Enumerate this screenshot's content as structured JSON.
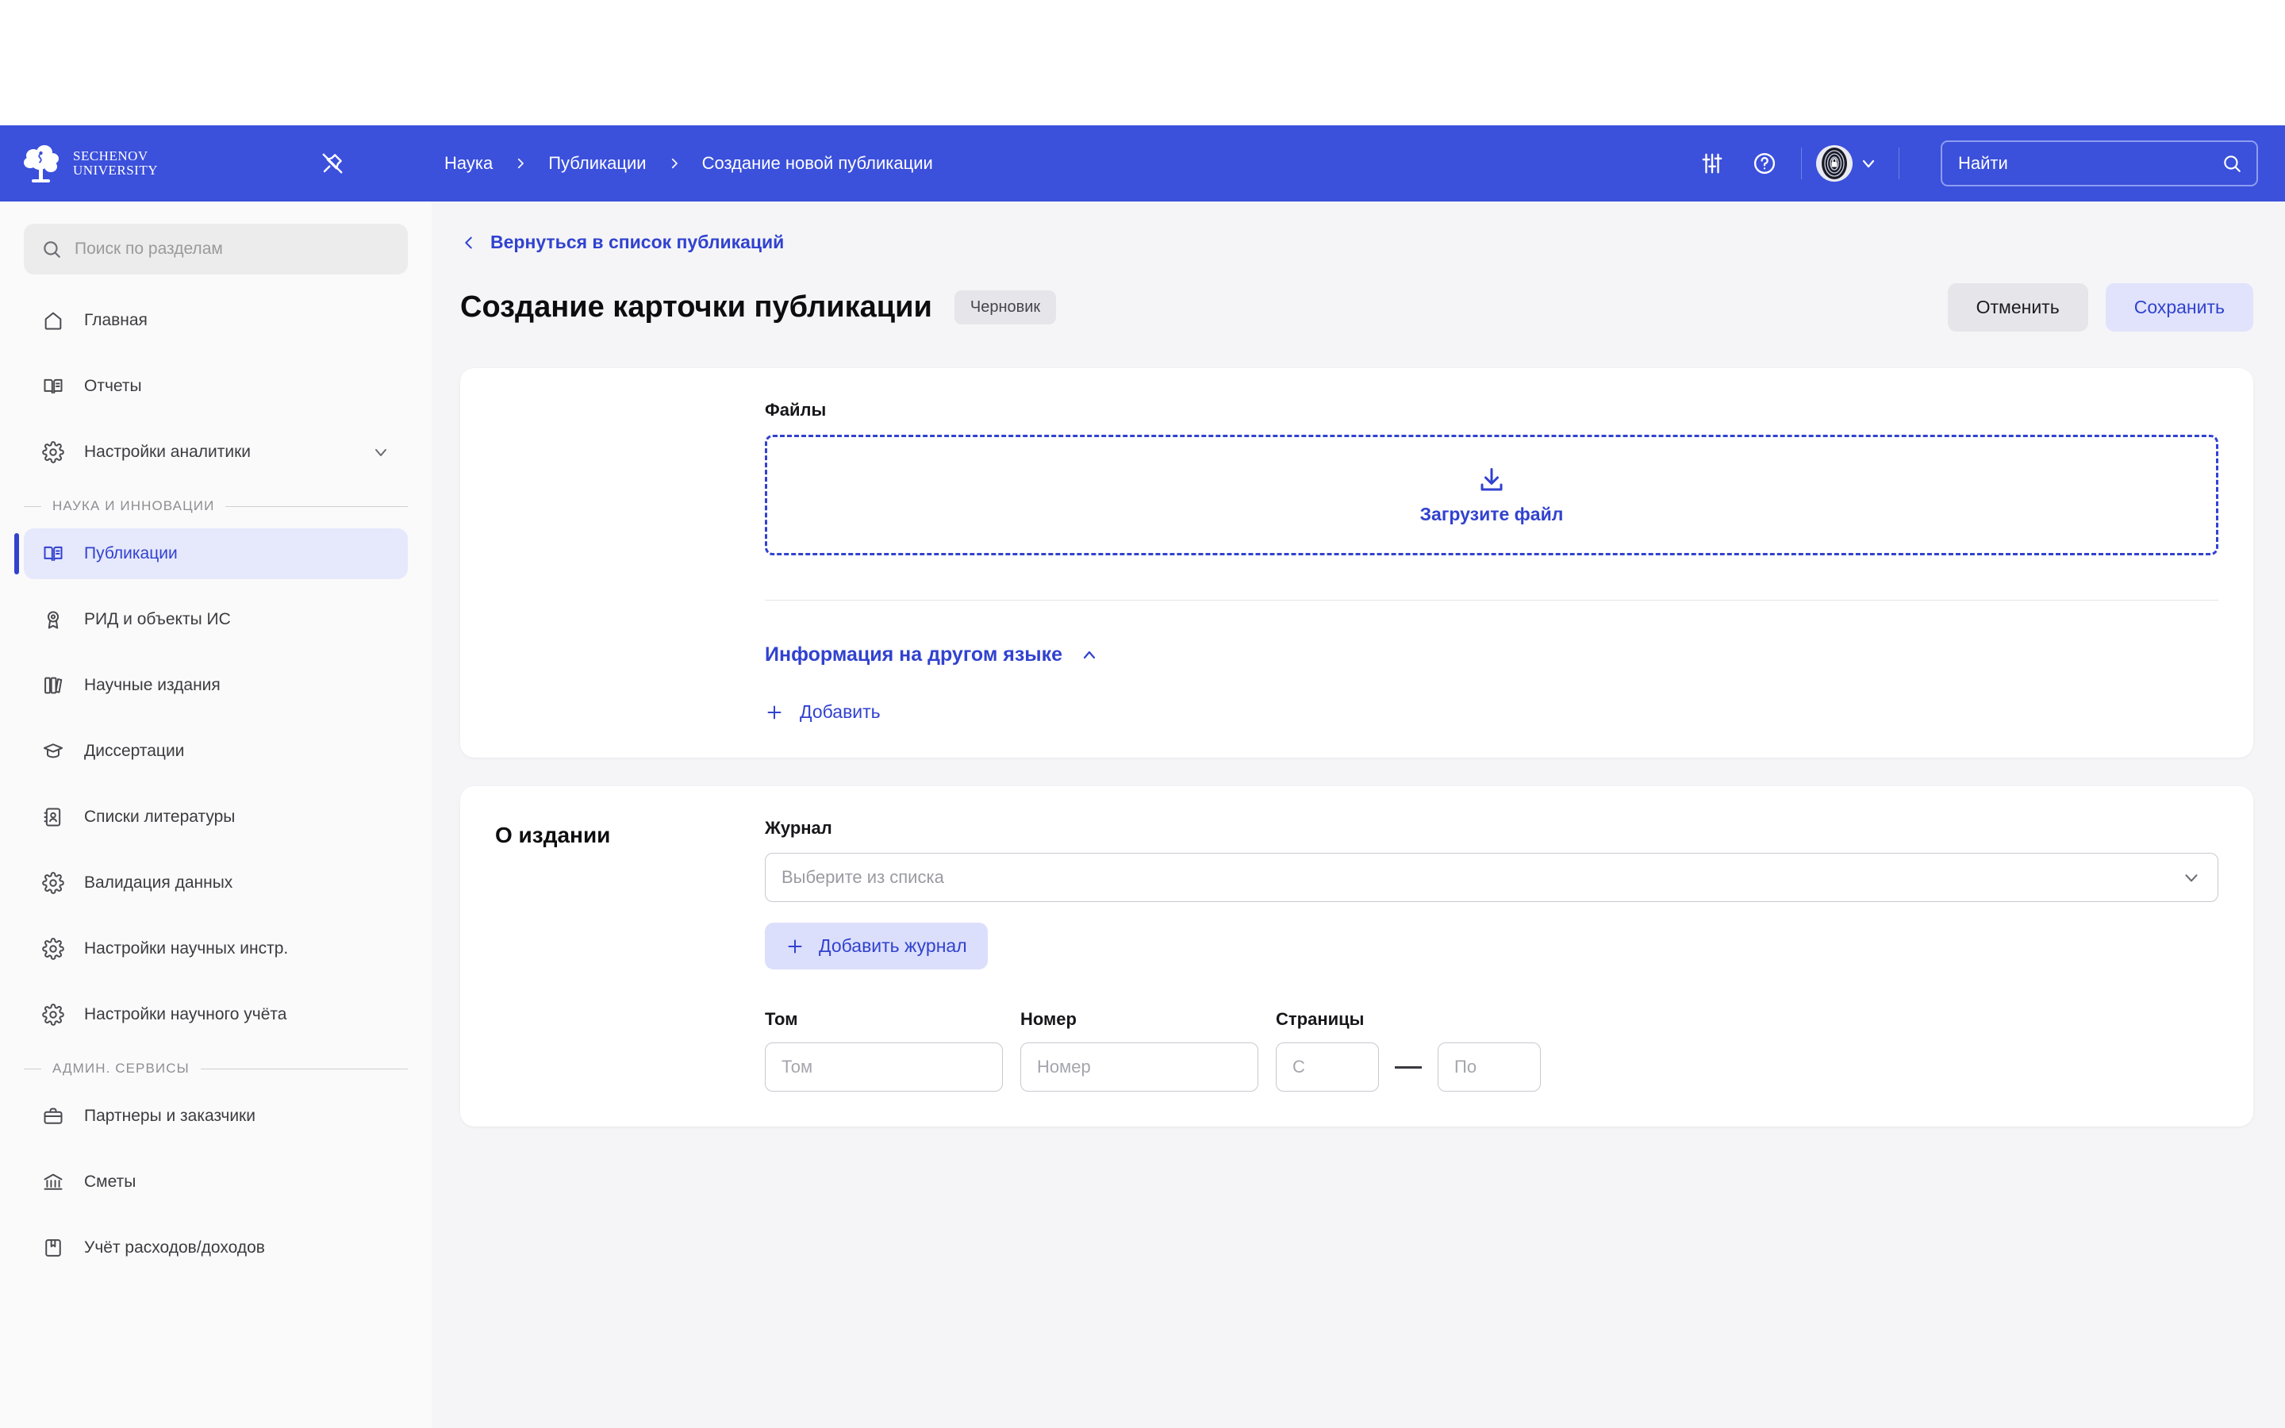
{
  "header": {
    "logo": {
      "line1": "SECHENOV",
      "line2": "UNIVERSITY",
      "icon": "sechenov-tree-logo"
    },
    "pin_icon": "pin-off-icon",
    "breadcrumb": [
      {
        "label": "Наука"
      },
      {
        "label": "Публикации"
      },
      {
        "label": "Создание новой публикации"
      }
    ],
    "icons": {
      "settings": "sliders-icon",
      "help": "help-circle-icon",
      "avatar": "user-avatar",
      "chevron": "chevron-down-icon"
    },
    "search": {
      "placeholder": "Найти",
      "value": "",
      "icon": "search-icon"
    },
    "accent_color": "#3B50DB"
  },
  "sidebar": {
    "search": {
      "placeholder": "Поиск по разделам",
      "value": "",
      "icon": "search-icon"
    },
    "items": [
      {
        "label": "Главная",
        "icon": "home-icon",
        "active": false
      },
      {
        "label": "Отчеты",
        "icon": "book-open-icon",
        "active": false
      },
      {
        "label": "Настройки аналитики",
        "icon": "gear-icon",
        "active": false,
        "expandable": true
      }
    ],
    "group_science": {
      "label": "НАУКА И ИННОВАЦИИ"
    },
    "science_items": [
      {
        "label": "Публикации",
        "icon": "book-open-icon",
        "active": true
      },
      {
        "label": "РИД и объекты ИС",
        "icon": "award-icon",
        "active": false
      },
      {
        "label": "Научные издания",
        "icon": "books-icon",
        "active": false
      },
      {
        "label": "Диссертации",
        "icon": "graduation-cap-icon",
        "active": false
      },
      {
        "label": "Списки литературы",
        "icon": "contact-book-icon",
        "active": false
      },
      {
        "label": "Валидация данных",
        "icon": "gear-icon",
        "active": false
      },
      {
        "label": "Настройки научных инстр.",
        "icon": "gear-icon",
        "active": false
      },
      {
        "label": "Настройки научного учёта",
        "icon": "gear-icon",
        "active": false
      }
    ],
    "group_admin": {
      "label": "АДМИН. СЕРВИСЫ"
    },
    "admin_items": [
      {
        "label": "Партнеры и заказчики",
        "icon": "briefcase-icon",
        "active": false
      },
      {
        "label": "Сметы",
        "icon": "bank-icon",
        "active": false
      },
      {
        "label": "Учёт расходов/доходов",
        "icon": "ledger-icon",
        "active": false
      }
    ],
    "active_bg": "#e6e8fc",
    "active_color": "#3142cf"
  },
  "main": {
    "back_link": {
      "label": "Вернуться в список публикаций",
      "icon": "chevron-left-icon"
    },
    "title": "Создание карточки публикации",
    "status_badge": "Черновик",
    "actions": {
      "cancel": "Отменить",
      "save": "Сохранить"
    },
    "files_section": {
      "files_label": "Файлы",
      "dropzone": {
        "text": "Загрузите файл",
        "icon": "download-icon"
      },
      "collapse": {
        "label": "Информация на другом языке",
        "icon": "chevron-up-icon"
      },
      "add": {
        "label": "Добавить",
        "icon": "plus-icon"
      }
    },
    "edition_section": {
      "section_label": "О издании",
      "journal": {
        "label": "Журнал",
        "placeholder": "Выберите из списка",
        "value": "",
        "icon": "chevron-down-icon"
      },
      "add_journal": {
        "label": "Добавить журнал",
        "icon": "plus-icon"
      },
      "volume": {
        "label": "Том",
        "placeholder": "Том",
        "value": ""
      },
      "number": {
        "label": "Номер",
        "placeholder": "Номер",
        "value": ""
      },
      "pages": {
        "label": "Страницы",
        "from_placeholder": "С",
        "from_value": "",
        "to_placeholder": "По",
        "to_value": ""
      }
    }
  }
}
